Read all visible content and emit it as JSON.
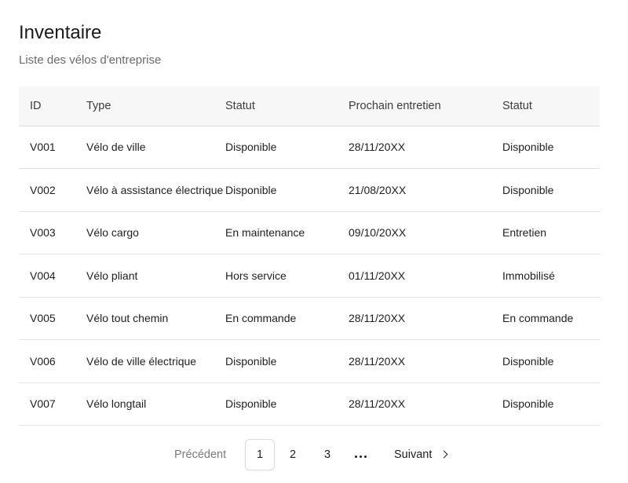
{
  "header": {
    "title": "Inventaire",
    "subtitle": "Liste des vélos d'entreprise"
  },
  "table": {
    "columns": [
      "ID",
      "Type",
      "Statut",
      "Prochain entretien",
      "Statut"
    ],
    "rows": [
      {
        "id": "V001",
        "type": "Vélo de ville",
        "status": "Disponible",
        "next_service": "28/11/20XX",
        "status2": "Disponible"
      },
      {
        "id": "V002",
        "type": "Vélo à assistance électrique",
        "status": "Disponible",
        "next_service": "21/08/20XX",
        "status2": "Disponible"
      },
      {
        "id": "V003",
        "type": "Vélo cargo",
        "status": "En maintenance",
        "next_service": "09/10/20XX",
        "status2": "Entretien"
      },
      {
        "id": "V004",
        "type": "Vélo pliant",
        "status": "Hors service",
        "next_service": "01/11/20XX",
        "status2": "Immobilisé"
      },
      {
        "id": "V005",
        "type": "Vélo tout chemin",
        "status": "En commande",
        "next_service": "28/11/20XX",
        "status2": "En commande"
      },
      {
        "id": "V006",
        "type": "Vélo de ville électrique",
        "status": "Disponible",
        "next_service": "28/11/20XX",
        "status2": "Disponible"
      },
      {
        "id": "V007",
        "type": "Vélo longtail",
        "status": "Disponible",
        "next_service": "28/11/20XX",
        "status2": "Disponible"
      }
    ]
  },
  "pagination": {
    "previous_label": "Précédent",
    "pages": [
      "1",
      "2",
      "3"
    ],
    "current_page": "1",
    "ellipsis_icon": "more-horizontal-icon",
    "next_label": "Suivant",
    "next_icon": "chevron-right-icon"
  }
}
